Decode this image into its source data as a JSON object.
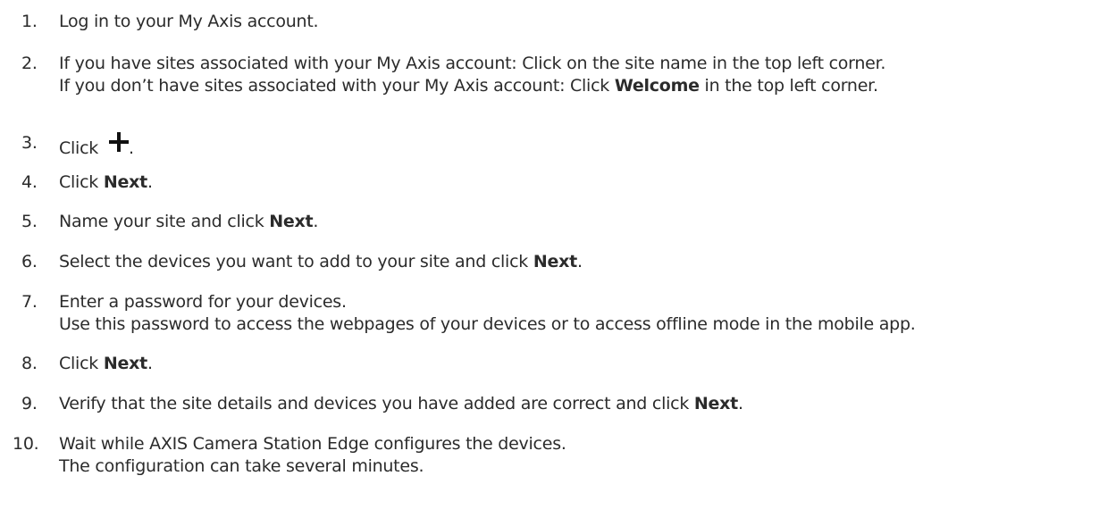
{
  "steps": [
    {
      "num": "1.",
      "lines": [
        {
          "pre": "Log in to your My Axis account.",
          "bold": "",
          "post": ""
        }
      ]
    },
    {
      "num": "2.",
      "lines": [
        {
          "pre": "If you have sites associated with your My Axis account: Click on the site name in the top left corner.",
          "bold": "",
          "post": ""
        },
        {
          "pre": "If you don’t have sites associated with your My Axis account: Click ",
          "bold": "Welcome",
          "post": " in the top left corner."
        }
      ]
    },
    {
      "num": "3.",
      "lines": [
        {
          "pre": "Click",
          "icon": "plus-icon",
          "post": "."
        }
      ]
    },
    {
      "num": "4.",
      "lines": [
        {
          "pre": "Click ",
          "bold": "Next",
          "post": "."
        }
      ]
    },
    {
      "num": "5.",
      "lines": [
        {
          "pre": "Name your site and click ",
          "bold": "Next",
          "post": "."
        }
      ]
    },
    {
      "num": "6.",
      "lines": [
        {
          "pre": "Select the devices you want to add to your site and click ",
          "bold": "Next",
          "post": "."
        }
      ]
    },
    {
      "num": "7.",
      "lines": [
        {
          "pre": "Enter a password for your devices.",
          "bold": "",
          "post": ""
        },
        {
          "pre": "Use this password to access the webpages of your devices or to access offline mode in the mobile app.",
          "bold": "",
          "post": ""
        }
      ]
    },
    {
      "num": "8.",
      "lines": [
        {
          "pre": "Click ",
          "bold": "Next",
          "post": "."
        }
      ]
    },
    {
      "num": "9.",
      "lines": [
        {
          "pre": "Verify that the site details and devices you have added are correct and click ",
          "bold": "Next",
          "post": "."
        }
      ]
    },
    {
      "num": "10.",
      "lines": [
        {
          "pre": "Wait while AXIS Camera Station Edge configures the devices.",
          "bold": "",
          "post": ""
        },
        {
          "pre": "The configuration can take several minutes.",
          "bold": "",
          "post": ""
        }
      ]
    }
  ]
}
